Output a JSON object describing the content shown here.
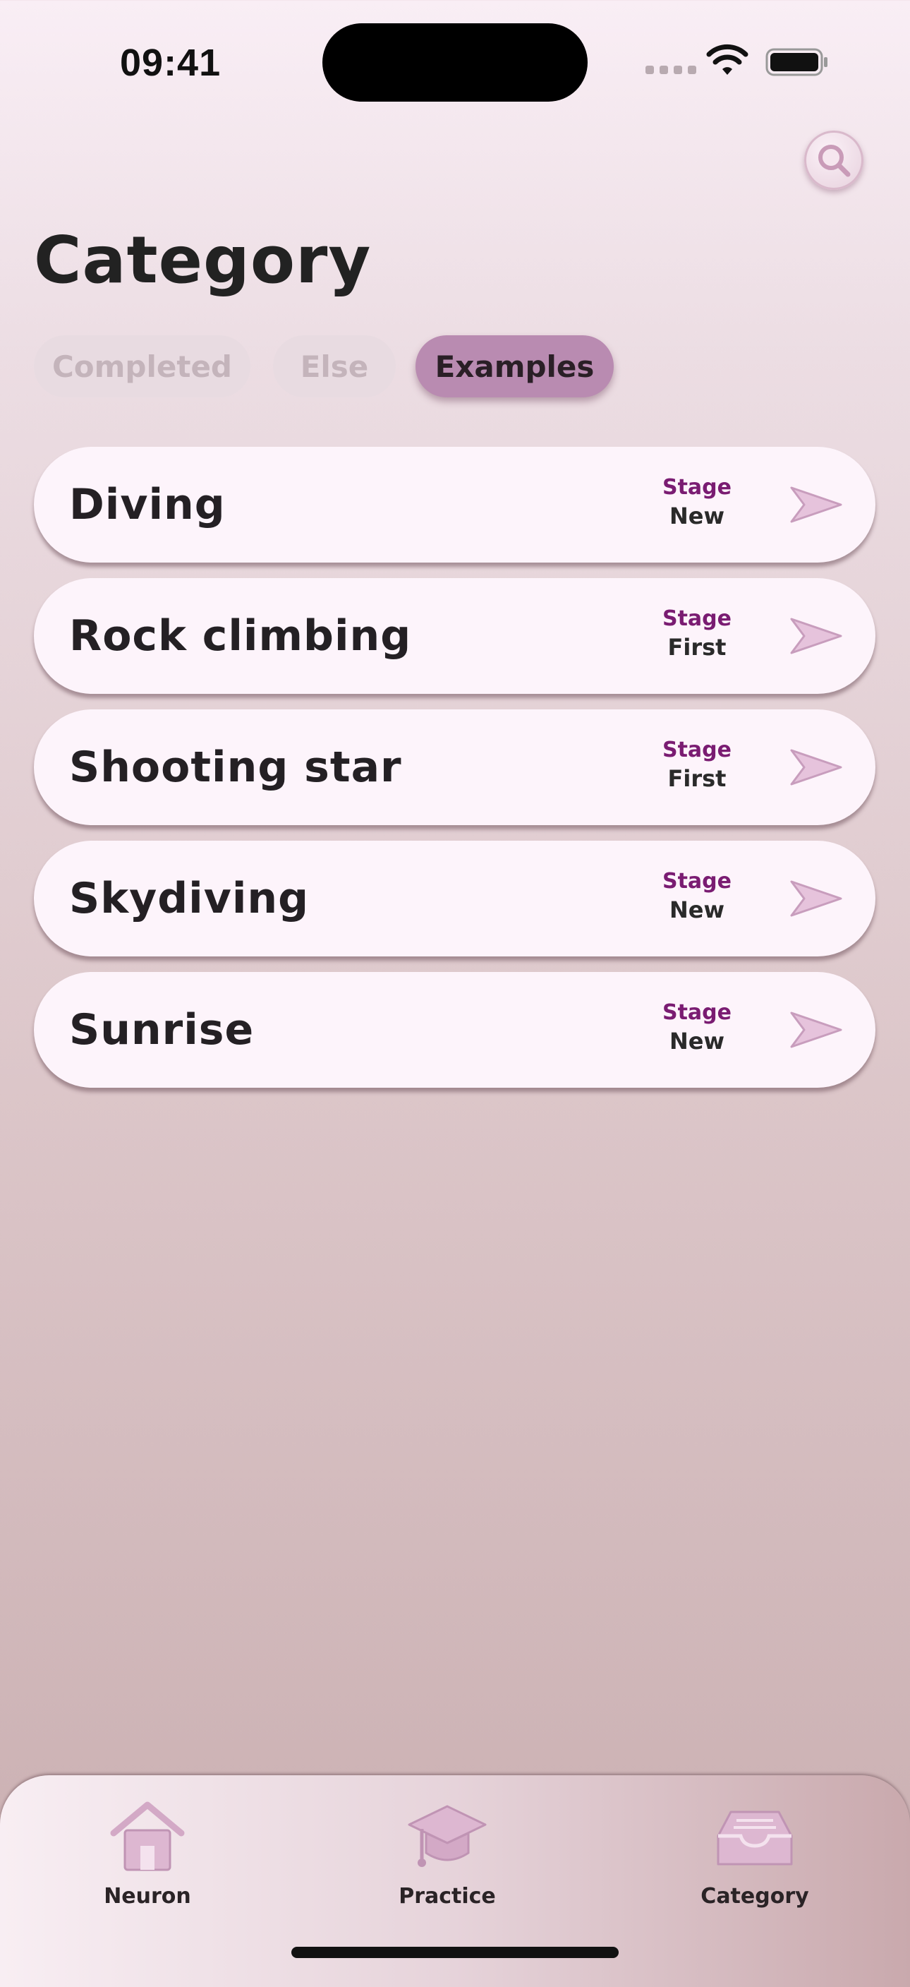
{
  "status_bar": {
    "time": "09:41"
  },
  "header": {
    "title": "Category",
    "search_icon": "search-icon"
  },
  "tabs": [
    {
      "label": "Completed",
      "active": false
    },
    {
      "label": "Else",
      "active": false
    },
    {
      "label": "Examples",
      "active": true
    }
  ],
  "items": [
    {
      "title": "Diving",
      "stage_label": "Stage",
      "stage": "New"
    },
    {
      "title": "Rock climbing",
      "stage_label": "Stage",
      "stage": "First"
    },
    {
      "title": "Shooting star",
      "stage_label": "Stage",
      "stage": "First"
    },
    {
      "title": "Skydiving",
      "stage_label": "Stage",
      "stage": "New"
    },
    {
      "title": "Sunrise",
      "stage_label": "Stage",
      "stage": "New"
    }
  ],
  "tab_bar": {
    "items": [
      {
        "label": "Neuron",
        "icon": "house-icon"
      },
      {
        "label": "Practice",
        "icon": "graduation-cap-icon"
      },
      {
        "label": "Category",
        "icon": "inbox-tray-icon"
      }
    ]
  },
  "colors": {
    "accent": "#b98bb1",
    "stage_label": "#7a1c72",
    "card": "#fdf4fb"
  }
}
